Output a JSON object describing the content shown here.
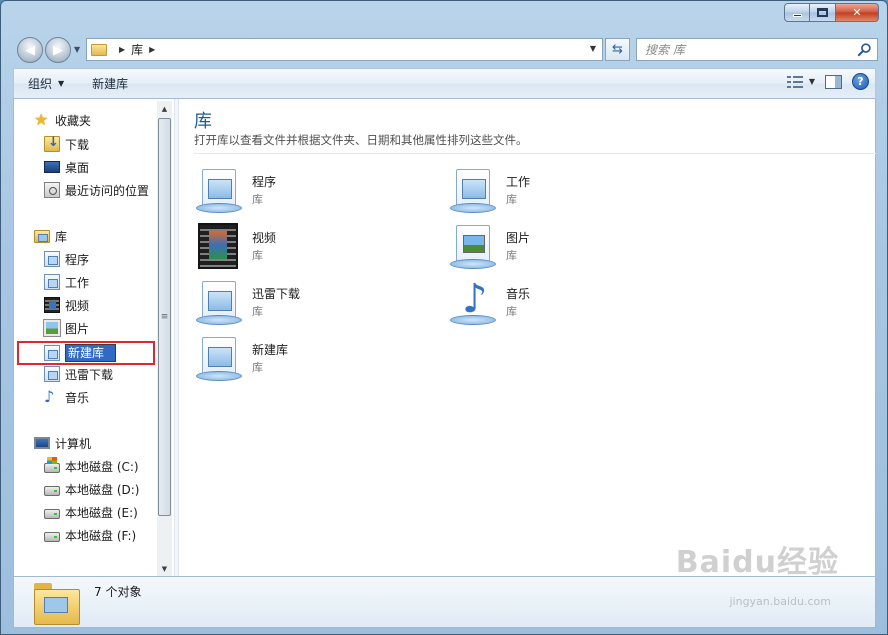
{
  "nav": {
    "breadcrumb": "库",
    "search_placeholder": "搜索 库"
  },
  "toolbar": {
    "organize": "组织",
    "new_library": "新建库"
  },
  "sidebar": {
    "favorites": "收藏夹",
    "downloads": "下载",
    "desktop": "桌面",
    "recent": "最近访问的位置",
    "libraries": "库",
    "lib_programs": "程序",
    "lib_work": "工作",
    "lib_video": "视频",
    "lib_pictures": "图片",
    "lib_new_edit": "新建库",
    "lib_xunlei": "迅雷下载",
    "lib_music": "音乐",
    "computer": "计算机",
    "drive_c": "本地磁盘 (C:)",
    "drive_d": "本地磁盘 (D:)",
    "drive_e": "本地磁盘 (E:)",
    "drive_f": "本地磁盘 (F:)"
  },
  "content": {
    "title": "库",
    "description": "打开库以查看文件并根据文件夹、日期和其他属性排列这些文件。",
    "items": [
      {
        "name": "程序",
        "type": "库",
        "icon": "library-icon"
      },
      {
        "name": "工作",
        "type": "库",
        "icon": "library-icon"
      },
      {
        "name": "视频",
        "type": "库",
        "icon": "video-library-icon"
      },
      {
        "name": "图片",
        "type": "库",
        "icon": "picture-library-icon"
      },
      {
        "name": "迅雷下载",
        "type": "库",
        "icon": "library-icon"
      },
      {
        "name": "音乐",
        "type": "库",
        "icon": "music-library-icon"
      },
      {
        "name": "新建库",
        "type": "库",
        "icon": "library-icon"
      }
    ]
  },
  "details": {
    "count": "7 个对象"
  },
  "watermark": {
    "brand": "Baidu经验",
    "url": "jingyan.baidu.com"
  },
  "colors": {
    "title_blue": "#1e5d8d",
    "selection_red": "#e3262b",
    "edit_highlight": "#316ac5"
  }
}
